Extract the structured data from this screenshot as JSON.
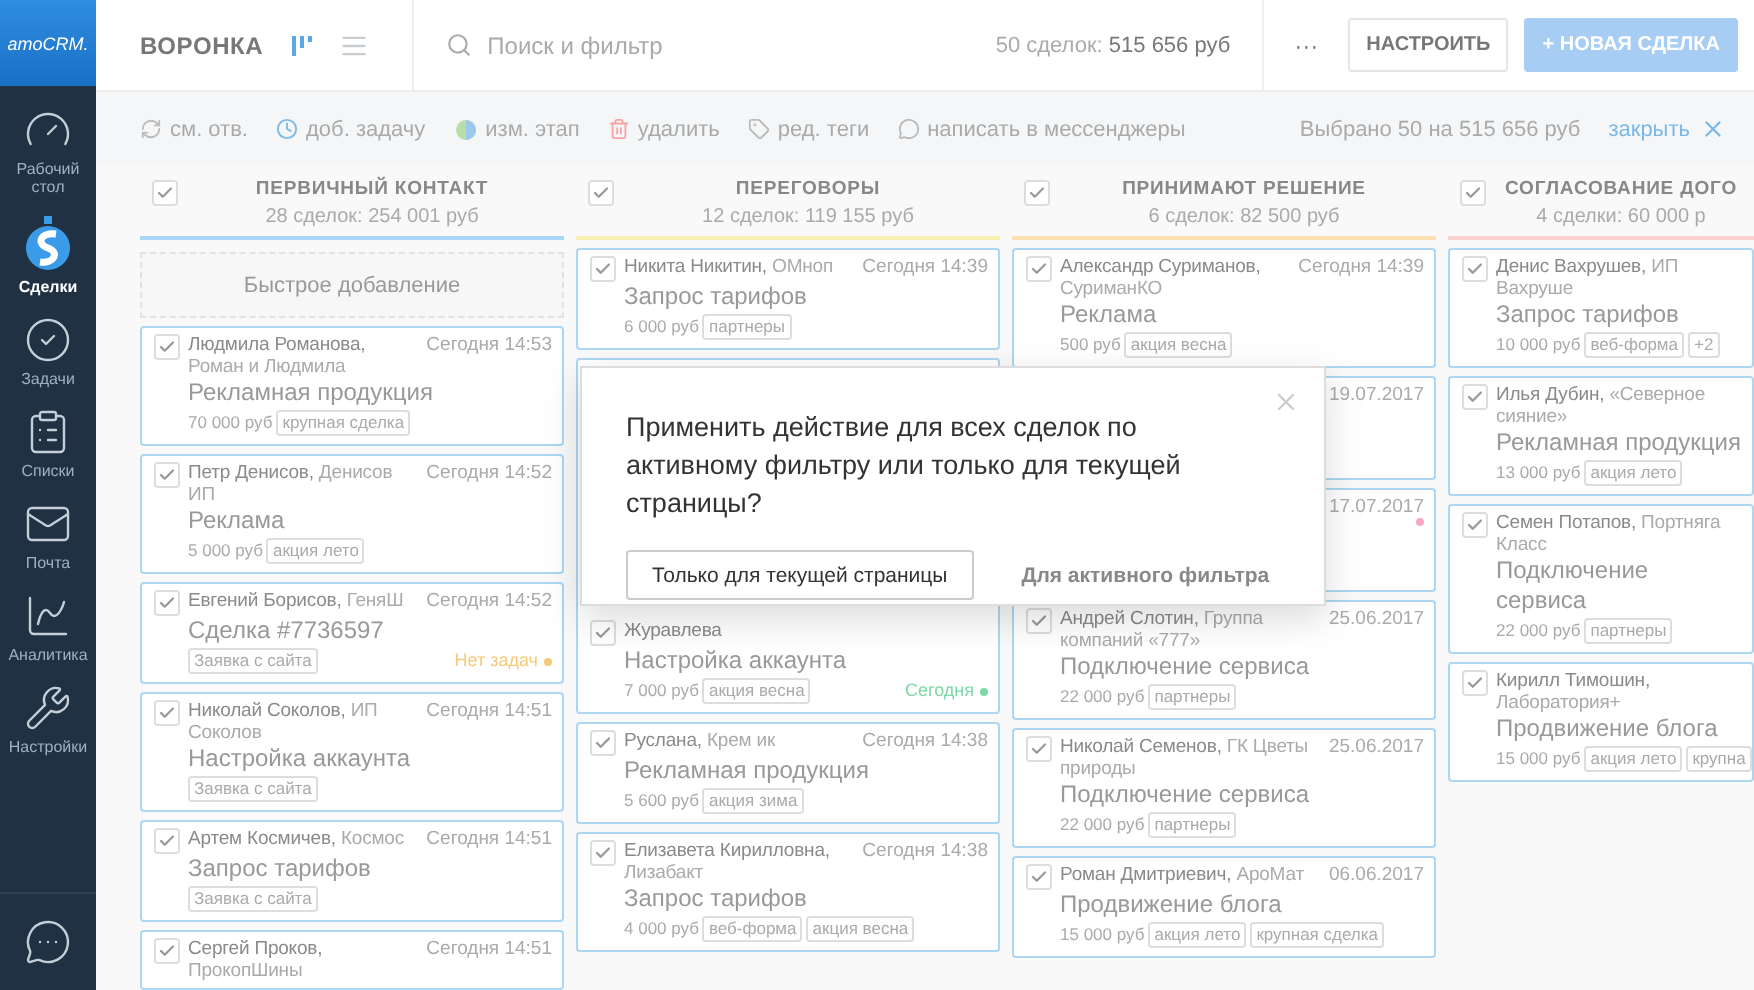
{
  "sidebar": {
    "logo": "amoCRM.",
    "items": [
      {
        "label": "Рабочий стол",
        "selected": false
      },
      {
        "label": "Сделки",
        "selected": true
      },
      {
        "label": "Задачи",
        "selected": false
      },
      {
        "label": "Списки",
        "selected": false
      },
      {
        "label": "Почта",
        "selected": false
      },
      {
        "label": "Аналитика",
        "selected": false
      },
      {
        "label": "Настройки",
        "selected": false
      }
    ]
  },
  "topbar": {
    "title": "ВОРОНКА",
    "views": [
      {
        "kind": "board",
        "selected": true
      },
      {
        "kind": "list",
        "selected": false
      }
    ],
    "search": {
      "placeholder": "Поиск и фильтр"
    },
    "count": "50 сделок:",
    "total": "515 656 руб",
    "more": "···",
    "buttons": [
      {
        "label": "НАСТРОИТЬ",
        "kind": "plain",
        "disabled": false
      },
      {
        "label": "+ НОВАЯ СДЕЛКА",
        "kind": "primary",
        "disabled": true
      }
    ]
  },
  "action_bar": {
    "actions": [
      "см. отв.",
      "доб. задачу",
      "изм. этап",
      "удалить",
      "ред. теги",
      "написать в мессенджеры"
    ],
    "selected_info": "Выбрано 50 на 515 656 руб",
    "close": "закрыть"
  },
  "columns": [
    {
      "title": "ПЕРВИЧНЫЙ КОНТАКТ",
      "summary": "28 сделок: 254 001 руб",
      "checked": true,
      "color": "#a9d7f5",
      "quick_add": "Быстрое добавление",
      "cards": [
        {
          "kind": "full",
          "checked": true,
          "person": "Людмила Романова,",
          "company": "Роман и Людмила",
          "time": "Сегодня 14:53",
          "name": "Рекламная продукция",
          "price": "70 000 руб",
          "tags": [
            "крупная сделка"
          ]
        },
        {
          "kind": "full",
          "checked": true,
          "person": "Петр Денисов,",
          "company": "Денисов ИП",
          "time": "Сегодня 14:52",
          "name": "Реклама",
          "price": "5 000 руб",
          "tags": [
            "акция лето"
          ]
        },
        {
          "kind": "full",
          "checked": true,
          "person": "Евгений Борисов,",
          "company": "ГеняШ",
          "time": "Сегодня 14:52",
          "name": "Сделка #7736597",
          "tags": [
            "Заявка с сайта"
          ],
          "task": {
            "label": "Нет задач",
            "color": "#f7c97a"
          }
        },
        {
          "kind": "full",
          "checked": true,
          "person": "Николай Соколов,",
          "company": "ИП Соколов",
          "time": "Сегодня 14:51",
          "name": "Настройка аккаунта",
          "tags": [
            "Заявка с сайта"
          ]
        },
        {
          "kind": "full",
          "checked": true,
          "person": "Артем Космичев,",
          "company": "Космос",
          "time": "Сегодня 14:51",
          "name": "Запрос тарифов",
          "tags": [
            "Заявка с сайта"
          ]
        },
        {
          "kind": "full",
          "checked": true,
          "person": "Сергей Проков,",
          "company": "ПрокопШины",
          "time": "Сегодня 14:51"
        }
      ]
    },
    {
      "title": "ПЕРЕГОВОРЫ",
      "summary": "12 сделок: 119 155 руб",
      "checked": true,
      "color": "#fbf0b4",
      "cards": [
        {
          "kind": "full",
          "checked": true,
          "person": "Никита Никитин,",
          "company": "ОМноп",
          "time": "Сегодня 14:39",
          "name": "Запрос тарифов",
          "price": "6 000 руб",
          "tags": [
            "партнеры"
          ]
        },
        {
          "kind": "tall_covered",
          "checked": true,
          "person": "Журавлева",
          "name": "Настройка аккаунта",
          "price": "7 000 руб",
          "tags": [
            "акция весна"
          ],
          "task": {
            "label": "Сегодня",
            "color": "#7dd8a6"
          }
        },
        {
          "kind": "full",
          "checked": true,
          "person": "Руслана,",
          "company": "Крем ик",
          "time": "Сегодня 14:38",
          "name": "Рекламная продукция",
          "price": "5 600 руб",
          "tags": [
            "акция зима"
          ]
        },
        {
          "kind": "full",
          "checked": true,
          "person": "Елизавета Кирилловна,",
          "company": "Лизабакт",
          "time": "Сегодня 14:38",
          "name": "Запрос тарифов",
          "price": "4 000 руб",
          "tags": [
            "веб-форма",
            "акция весна"
          ]
        }
      ]
    },
    {
      "title": "ПРИНИМАЮТ РЕШЕНИЕ",
      "summary": "6 сделок: 82 500 руб",
      "checked": true,
      "color": "#fbe1b0",
      "cards": [
        {
          "kind": "full",
          "checked": true,
          "person": "Александр Суриманов,",
          "company": "СуриманКО",
          "time": "Сегодня 14:39",
          "name": "Реклама",
          "price": "500 руб",
          "tags": [
            "акция весна"
          ]
        },
        {
          "kind": "covered",
          "time": "19.07.2017"
        },
        {
          "kind": "covered",
          "time": "17.07.2017",
          "task": {
            "color": "#f7a8c0"
          }
        },
        {
          "kind": "full",
          "checked": true,
          "person": "Андрей Слотин,",
          "company": "Группа компаний «777»",
          "time": "25.06.2017",
          "name": "Подключение сервиса",
          "price": "22 000 руб",
          "tags": [
            "партнеры"
          ]
        },
        {
          "kind": "full",
          "checked": true,
          "person": "Николай Семенов,",
          "company": "ГК Цветы природы",
          "time": "25.06.2017",
          "name": "Подключение сервиса",
          "price": "22 000 руб",
          "tags": [
            "партнеры"
          ]
        },
        {
          "kind": "full",
          "checked": true,
          "person": "Роман Дмитриевич,",
          "company": "АроМат",
          "time": "06.06.2017",
          "name": "Продвижение блога",
          "price": "15 000 руб",
          "tags": [
            "акция лето",
            "крупная сделка"
          ]
        }
      ]
    },
    {
      "title": "СОГЛАСОВАНИЕ ДОГО",
      "summary": "4 сделки: 60 000 р",
      "checked": true,
      "color": "#fbd2d2",
      "cards": [
        {
          "kind": "full",
          "checked": true,
          "person": "Денис Вахрушев,",
          "company": "ИП Вахруше",
          "name": "Запрос тарифов",
          "price": "10 000 руб",
          "tags": [
            "веб-форма",
            "+2"
          ]
        },
        {
          "kind": "full",
          "checked": true,
          "person": "Илья Дубин,",
          "company": "«Северное сияние»",
          "name": "Рекламная продукция",
          "price": "13 000 руб",
          "tags": [
            "акция лето"
          ]
        },
        {
          "kind": "full",
          "checked": true,
          "person": "Семен Потапов,",
          "company": "Портняга Класс",
          "name": "Подключение сервиса",
          "price": "22 000 руб",
          "tags": [
            "партнеры"
          ]
        },
        {
          "kind": "full",
          "checked": true,
          "person": "Кирилл Тимошин,",
          "company": "Лаборатория+",
          "name": "Продвижение блога",
          "price": "15 000 руб",
          "tags": [
            "акция лето",
            "крупна"
          ]
        }
      ]
    }
  ],
  "modal": {
    "message": "Применить действие для всех сделок по активному фильтру или только для текущей страницы?",
    "buttons": [
      {
        "label": "Только для текущей страницы",
        "kind": "outlined"
      },
      {
        "label": "Для активного фильтра",
        "kind": "link"
      }
    ]
  }
}
